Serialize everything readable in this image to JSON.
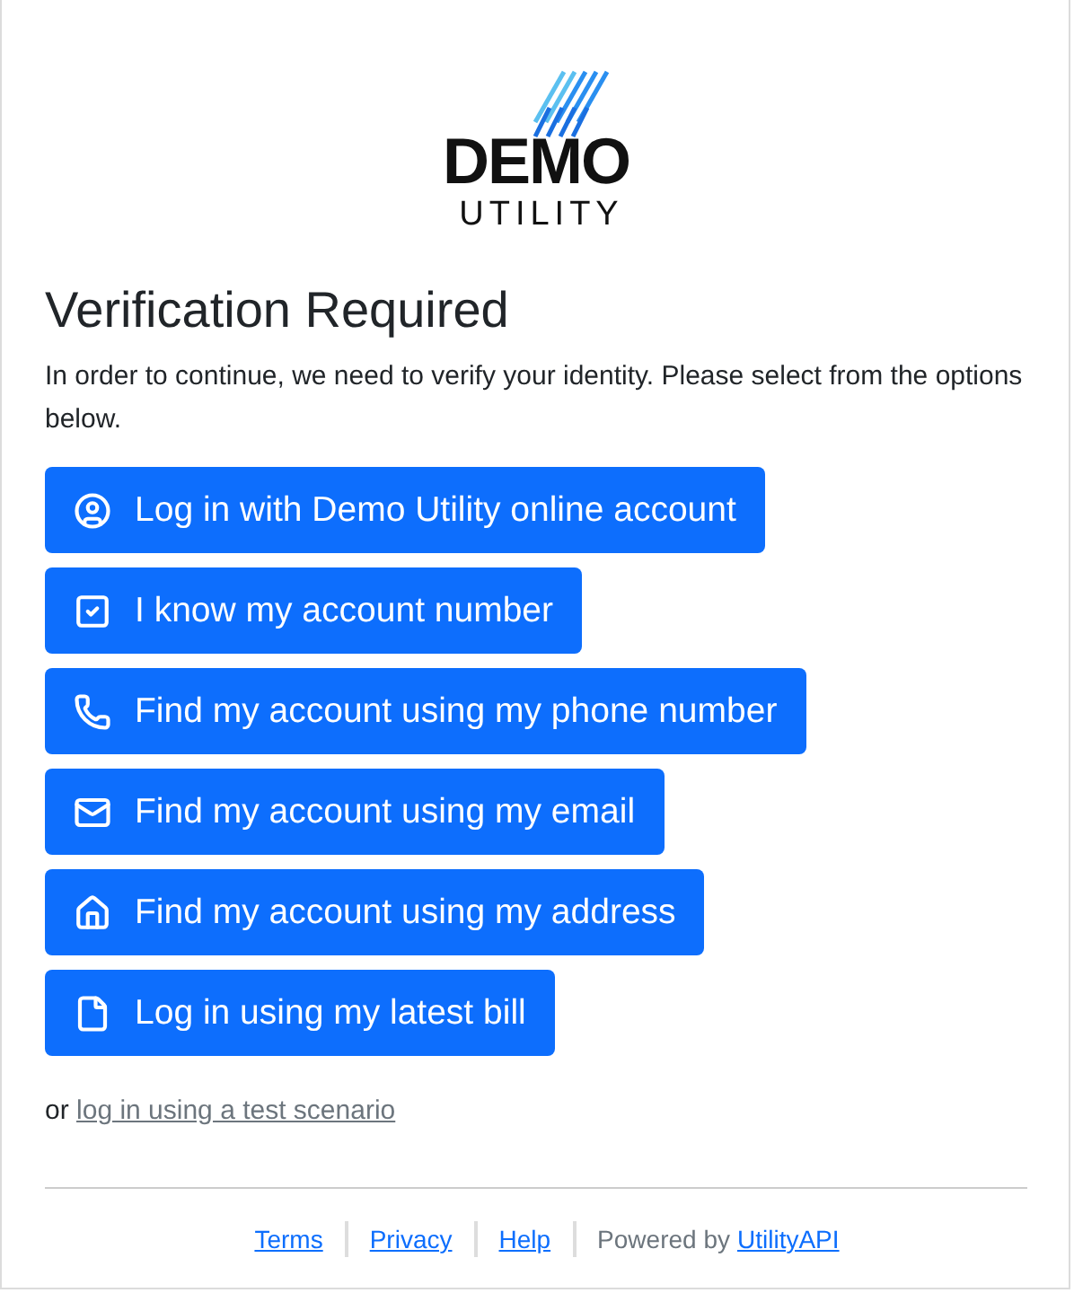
{
  "logo": {
    "name": "DEMO",
    "subtitle": "UTILITY"
  },
  "title": "Verification Required",
  "intro": "In order to continue, we need to verify your identity. Please select from the options below.",
  "options": [
    {
      "kind": "user",
      "label": "Log in with Demo Utility online account"
    },
    {
      "kind": "check",
      "label": "I know my account number"
    },
    {
      "kind": "phone",
      "label": "Find my account using my phone number"
    },
    {
      "kind": "mail",
      "label": "Find my account using my email"
    },
    {
      "kind": "home",
      "label": "Find my account using my address"
    },
    {
      "kind": "file",
      "label": "Log in using my latest bill"
    }
  ],
  "alternative": {
    "prefix": "or",
    "link": "log in using a test scenario"
  },
  "footer": {
    "links": [
      "Terms",
      "Privacy",
      "Help"
    ],
    "powered_by": "Powered by",
    "powered_link": "UtilityAPI"
  }
}
